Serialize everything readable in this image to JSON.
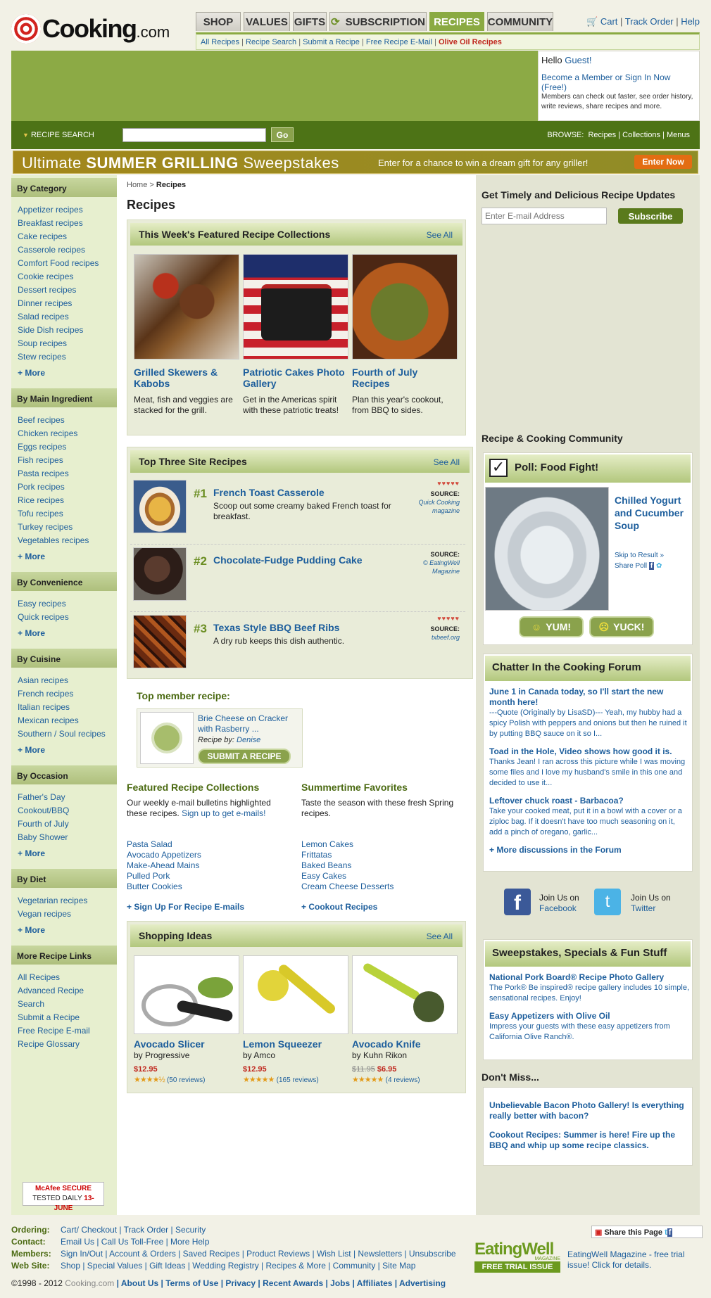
{
  "header": {
    "brand": "Cooking",
    "brand_suffix": ".com",
    "tabs": [
      "SHOP",
      "VALUES",
      "GIFTS",
      "SUBSCRIPTION",
      "RECIPES",
      "COMMUNITY"
    ],
    "active_tab": "RECIPES",
    "cart": "Cart",
    "track": "Track Order",
    "help": "Help",
    "subnav": [
      "All Recipes",
      "Recipe Search",
      "Submit a Recipe",
      "Free Recipe E-Mail"
    ],
    "subnav_hot": "Olive Oil Recipes"
  },
  "welcome": {
    "hello": "Hello",
    "guest": "Guest!",
    "member_link": "Become a Member or Sign In Now (Free!)",
    "note": "Members can check out faster, see order history, write reviews, share recipes and more."
  },
  "search": {
    "label": "RECIPE SEARCH",
    "button": "Go",
    "browse_label": "BROWSE:",
    "browse_links": [
      "Recipes",
      "Collections",
      "Menus"
    ]
  },
  "sweeps": {
    "title_a": "Ultimate",
    "title_b": "SUMMER GRILLING",
    "title_c": "Sweepstakes",
    "text": "Enter for a chance to win a dream gift for any griller!",
    "button": "Enter Now"
  },
  "left": {
    "sections": [
      {
        "title": "By Category",
        "items": [
          "Appetizer recipes",
          "Breakfast recipes",
          "Cake recipes",
          "Casserole recipes",
          "Comfort Food recipes",
          "Cookie recipes",
          "Dessert recipes",
          "Dinner recipes",
          "Salad recipes",
          "Side Dish recipes",
          "Soup recipes",
          "Stew recipes"
        ],
        "more": "+ More"
      },
      {
        "title": "By Main Ingredient",
        "items": [
          "Beef recipes",
          "Chicken recipes",
          "Eggs recipes",
          "Fish recipes",
          "Pasta recipes",
          "Pork recipes",
          "Rice recipes",
          "Tofu recipes",
          "Turkey recipes",
          "Vegetables recipes"
        ],
        "more": "+ More"
      },
      {
        "title": "By Convenience",
        "items": [
          "Easy recipes",
          "Quick recipes"
        ],
        "more": "+ More"
      },
      {
        "title": "By Cuisine",
        "items": [
          "Asian recipes",
          "French recipes",
          "Italian recipes",
          "Mexican recipes",
          "Southern / Soul recipes"
        ],
        "more": "+ More"
      },
      {
        "title": "By Occasion",
        "items": [
          "Father's Day",
          "Cookout/BBQ",
          "Fourth of July",
          "Baby Shower"
        ],
        "more": "+ More"
      },
      {
        "title": "By Diet",
        "items": [
          "Vegetarian recipes",
          "Vegan recipes"
        ],
        "more": "+ More"
      },
      {
        "title": "More Recipe Links",
        "items": [
          "All Recipes",
          "Advanced Recipe Search",
          "Submit a Recipe",
          "Free Recipe E-mail",
          "Recipe Glossary"
        ],
        "more": ""
      }
    ],
    "mcafee_a": "McAfee SECURE",
    "mcafee_b": "TESTED DAILY",
    "mcafee_date": "13-JUNE"
  },
  "main": {
    "crumb_home": "Home",
    "crumb_sep": ">",
    "crumb_current": "Recipes",
    "title": "Recipes",
    "featured": {
      "heading": "This Week's Featured Recipe Collections",
      "see_all": "See All",
      "items": [
        {
          "title": "Grilled Skewers & Kabobs",
          "desc": "Meat, fish and veggies are stacked for the grill."
        },
        {
          "title": "Patriotic Cakes Photo Gallery",
          "desc": "Get in the Americas spirit with these patriotic treats!"
        },
        {
          "title": "Fourth of July Recipes",
          "desc": "Plan this year's cookout, from BBQ to sides."
        }
      ]
    },
    "top3": {
      "heading": "Top Three Site Recipes",
      "see_all": "See All",
      "source_label": "SOURCE:",
      "items": [
        {
          "rank": "#1",
          "title": "French Toast Casserole",
          "desc": "Scoop out some creamy baked French toast for breakfast.",
          "source": "Quick Cooking magazine"
        },
        {
          "rank": "#2",
          "title": "Chocolate-Fudge Pudding Cake",
          "desc": "",
          "source": "© EatingWell Magazine"
        },
        {
          "rank": "#3",
          "title": "Texas Style BBQ Beef Ribs",
          "desc": "A dry rub keeps this dish authentic.",
          "source": "txbeef.org"
        }
      ]
    },
    "member": {
      "heading": "Top member recipe:",
      "title": "Brie Cheese on Cracker with Rasberry ...",
      "by": "Recipe by:",
      "author": "Denise",
      "button": "SUBMIT A RECIPE"
    },
    "fcoll": {
      "heading": "Featured Recipe Collections",
      "intro": "Our weekly e-mail bulletins highlighted these recipes.",
      "intro_link": "Sign up to get e-mails!",
      "items": [
        "Pasta Salad",
        "Avocado Appetizers",
        "Make-Ahead Mains",
        "Pulled Pork",
        "Butter Cookies"
      ],
      "more": "+ Sign Up For Recipe E-mails"
    },
    "summer": {
      "heading": "Summertime Favorites",
      "intro": "Taste the season with these fresh Spring recipes.",
      "items": [
        "Lemon Cakes",
        "Frittatas",
        "Baked Beans",
        "Easy Cakes",
        "Cream Cheese Desserts"
      ],
      "more": "+ Cookout Recipes"
    },
    "shopping": {
      "heading": "Shopping Ideas",
      "see_all": "See All",
      "items": [
        {
          "title": "Avocado Slicer",
          "by": "by Progressive",
          "old": "",
          "price": "$12.95",
          "stars": "★★★★½",
          "reviews": "(50 reviews)",
          "rating": 4.5
        },
        {
          "title": "Lemon Squeezer",
          "by": "by Amco",
          "old": "",
          "price": "$12.95",
          "stars": "★★★★★",
          "reviews": "(165 reviews)",
          "rating": 5
        },
        {
          "title": "Avocado Knife",
          "by": "by Kuhn Rikon",
          "old": "$11.95",
          "price": "$6.95",
          "stars": "★★★★★",
          "reviews": "(4 reviews)",
          "rating": 5
        }
      ]
    }
  },
  "right": {
    "updates_heading": "Get Timely and Delicious Recipe Updates",
    "email_placeholder": "Enter E-mail Address",
    "subscribe": "Subscribe",
    "community_heading": "Recipe & Cooking Community",
    "poll_title": "Poll: Food Fight!",
    "poll_item": "Chilled Yogurt and Cucumber Soup",
    "skip": "Skip to Result »",
    "share": "Share Poll",
    "yum": "YUM!",
    "yuck": "YUCK!",
    "forum_heading": "Chatter In the Cooking Forum",
    "forum": [
      {
        "title": "June 1 in Canada today, so I'll start the new month here!",
        "text": "---Quote (Originally by LisaSD)--- Yeah, my hubby had a spicy Polish with peppers and onions but then he ruined it by putting BBQ sauce on it so I..."
      },
      {
        "title": "Toad in the Hole, Video shows how good it is.",
        "text": "Thanks Jean! I ran across this picture while I was moving some files and I love my husband's smile in this one and decided to use it..."
      },
      {
        "title": "Leftover chuck roast - Barbacoa?",
        "text": "Take your cooked meat, put it in a bowl with a cover or a ziploc bag. If it doesn't have too much seasoning on it, add a pinch of oregano, garlic..."
      }
    ],
    "forum_more": "+ More discussions in the Forum",
    "join_label": "Join Us on",
    "facebook": "Facebook",
    "twitter": "Twitter",
    "specials_heading": "Sweepstakes, Specials & Fun Stuff",
    "specials": [
      {
        "title": "National Pork Board® Recipe Photo Gallery",
        "text": "The Pork® Be inspired® recipe gallery includes 10 simple, sensational recipes. Enjoy!"
      },
      {
        "title": "Easy Appetizers with Olive Oil",
        "text": "Impress your guests with these easy appetizers from California Olive Ranch®."
      }
    ],
    "dont_miss_heading": "Don't Miss...",
    "dont_miss": [
      "Unbelievable Bacon Photo Gallery! Is everything really better with bacon?",
      "Cookout Recipes: Summer is here! Fire up the BBQ and whip up some recipe classics."
    ]
  },
  "footer": {
    "rows": [
      {
        "k": "Ordering:",
        "v": "Cart/ Checkout | Track Order | Security"
      },
      {
        "k": "Contact:",
        "v": "Email Us | Call Us Toll-Free | More Help"
      },
      {
        "k": "Members:",
        "v": "Sign In/Out | Account & Orders | Saved Recipes | Product Reviews | Wish List | Newsletters | Unsubscribe"
      },
      {
        "k": "Web Site:",
        "v": "Shop | Special Values | Gift Ideas | Wedding Registry | Recipes & More | Community | Site Map"
      }
    ],
    "copy_a": "©1998 - 2012",
    "copy_b": "Cooking.com",
    "copy_links": "| About Us | Terms of Use | Privacy | Recent Awards | Jobs | Affiliates | Advertising",
    "share": "Share this Page",
    "ew_logo": "EatingWell",
    "ew_mag": "MAGAZINE",
    "ew_trial": "FREE TRIAL ISSUE",
    "ew_text": "EatingWell Magazine - free trial issue! Click for details."
  }
}
